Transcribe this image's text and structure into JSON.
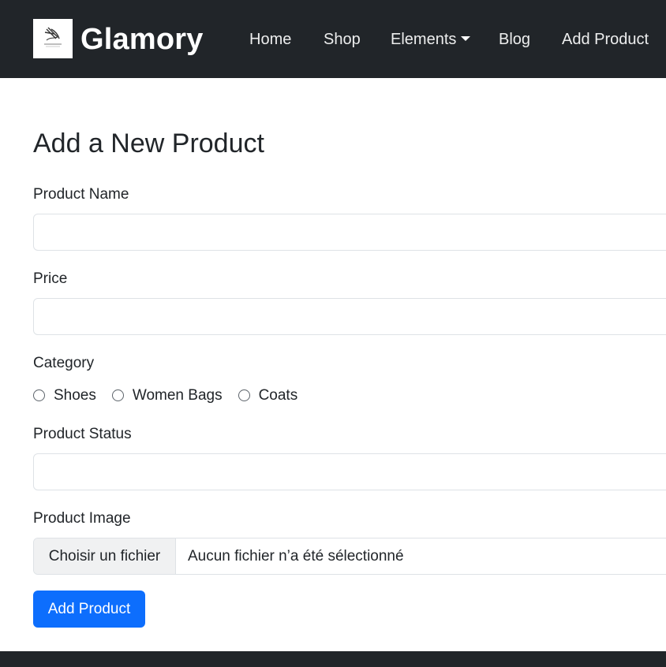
{
  "brand": {
    "name": "Glamory"
  },
  "nav": {
    "items": [
      {
        "label": "Home"
      },
      {
        "label": "Shop"
      },
      {
        "label": "Elements"
      },
      {
        "label": "Blog"
      },
      {
        "label": "Add Product"
      }
    ]
  },
  "form": {
    "title": "Add a New Product",
    "product_name": {
      "label": "Product Name",
      "value": ""
    },
    "price": {
      "label": "Price",
      "value": ""
    },
    "category": {
      "label": "Category",
      "options": [
        {
          "label": "Shoes",
          "checked": false
        },
        {
          "label": "Women Bags",
          "checked": false
        },
        {
          "label": "Coats",
          "checked": false
        }
      ]
    },
    "product_status": {
      "label": "Product Status",
      "value": ""
    },
    "product_image": {
      "label": "Product Image",
      "button_label": "Choisir un fichier",
      "status_text": "Aucun fichier n’a été sélectionné"
    },
    "submit_label": "Add Product"
  },
  "colors": {
    "navbar_bg": "#212529",
    "primary": "#0d6efd",
    "input_border": "#dee2e6"
  }
}
